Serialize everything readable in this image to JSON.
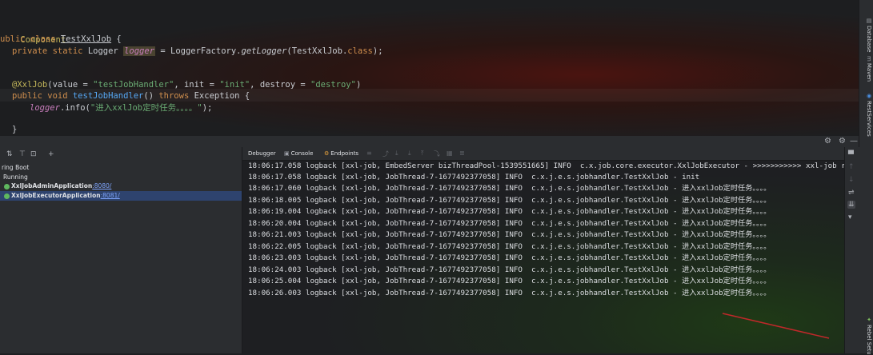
{
  "editor": {
    "code": {
      "l1": {
        "ann": "Component"
      },
      "l2": {
        "kw": "ublic class ",
        "cls": "TestXxlJob",
        "rest": " {"
      },
      "l3": {
        "kw": "private static ",
        "type": "Logger ",
        "var": "logger",
        "eq": " = LoggerFactory.",
        "method": "getLogger",
        "rest": "(TestXxlJob.",
        "kw2": "class",
        "end": ");"
      },
      "l4": {
        "ann": "@XxlJob",
        "p1": "(value = ",
        "s1": "\"testJobHandler\"",
        "p2": ", init = ",
        "s2": "\"init\"",
        "p3": ", destroy = ",
        "s3": "\"destroy\"",
        "p4": ")"
      },
      "l5": {
        "kw": "public void ",
        "method": "testJobHandler",
        "p1": "() ",
        "kw2": "throws ",
        "exc": "Exception",
        "rest": " {"
      },
      "l6": {
        "var": "logger",
        "p1": ".info(",
        "str": "\"进入xxlJob定时任务。。。。\"",
        "rest": ");"
      },
      "l7": {
        "text": "}"
      }
    }
  },
  "right_toolbar": {
    "tabs": [
      {
        "label": "Database",
        "icon": "database-icon"
      },
      {
        "label": "Maven",
        "icon": "maven-icon"
      },
      {
        "label": "RestServices",
        "icon": "rest-services-icon"
      },
      {
        "label": "Rebel Setu",
        "icon": "rebel-icon"
      }
    ]
  },
  "services": {
    "header_controls": {
      "settings": "⚙",
      "gear": "⚙",
      "minimize": "—"
    },
    "toolbar": {
      "icons": [
        "expand-all-icon",
        "filter-icon",
        "group-icon",
        "add-icon"
      ]
    },
    "tree": {
      "root": "ring Boot",
      "running": "Running",
      "apps": [
        {
          "name": "XxlJobAdminApplication",
          "port": ":8080/"
        },
        {
          "name": "XxlJobExecutorApplication",
          "port": ":8081/"
        }
      ]
    }
  },
  "console": {
    "tabs": [
      {
        "label": "Debugger",
        "icon": "debugger-icon"
      },
      {
        "label": "Console",
        "icon": "console-icon"
      },
      {
        "label": "Endpoints",
        "icon": "endpoints-icon"
      }
    ],
    "lines": [
      "18:06:17.058 logback [xxl-job, EmbedServer bizThreadPool-1539551665] INFO  c.x.job.core.executor.XxlJobExecutor - >>>>>>>>>>> xxl-job regis",
      "18:06:17.058 logback [xxl-job, JobThread-7-1677492377058] INFO  c.x.j.e.s.jobhandler.TestXxlJob - init",
      "18:06:17.060 logback [xxl-job, JobThread-7-1677492377058] INFO  c.x.j.e.s.jobhandler.TestXxlJob - 进入xxlJob定时任务。。。。",
      "18:06:18.005 logback [xxl-job, JobThread-7-1677492377058] INFO  c.x.j.e.s.jobhandler.TestXxlJob - 进入xxlJob定时任务。。。。",
      "18:06:19.004 logback [xxl-job, JobThread-7-1677492377058] INFO  c.x.j.e.s.jobhandler.TestXxlJob - 进入xxlJob定时任务。。。。",
      "18:06:20.004 logback [xxl-job, JobThread-7-1677492377058] INFO  c.x.j.e.s.jobhandler.TestXxlJob - 进入xxlJob定时任务。。。。",
      "18:06:21.003 logback [xxl-job, JobThread-7-1677492377058] INFO  c.x.j.e.s.jobhandler.TestXxlJob - 进入xxlJob定时任务。。。。",
      "18:06:22.005 logback [xxl-job, JobThread-7-1677492377058] INFO  c.x.j.e.s.jobhandler.TestXxlJob - 进入xxlJob定时任务。。。。",
      "18:06:23.003 logback [xxl-job, JobThread-7-1677492377058] INFO  c.x.j.e.s.jobhandler.TestXxlJob - 进入xxlJob定时任务。。。。",
      "18:06:24.003 logback [xxl-job, JobThread-7-1677492377058] INFO  c.x.j.e.s.jobhandler.TestXxlJob - 进入xxlJob定时任务。。。。",
      "18:06:25.004 logback [xxl-job, JobThread-7-1677492377058] INFO  c.x.j.e.s.jobhandler.TestXxlJob - 进入xxlJob定时任务。。。。",
      "18:06:26.003 logback [xxl-job, JobThread-7-1677492377058] INFO  c.x.j.e.s.jobhandler.TestXxlJob - 进入xxlJob定时任务。。。。"
    ],
    "side_tools": [
      "scroll-up-icon",
      "scroll-down-icon",
      "soft-wrap-icon",
      "scroll-to-end-icon",
      "print-icon",
      "clear-icon"
    ]
  },
  "colors": {
    "annotation_arrow": "#c0282a",
    "selection": "#2e436e",
    "keyword": "#cf8e4d",
    "string": "#6aab73"
  }
}
